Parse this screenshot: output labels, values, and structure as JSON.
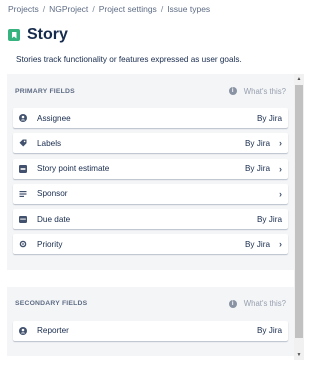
{
  "breadcrumb": {
    "items": [
      "Projects",
      "NGProject",
      "Project settings",
      "Issue types"
    ],
    "separator": "/"
  },
  "page": {
    "title": "Story",
    "icon": "story-icon",
    "description": "Stories track functionality or features expressed as user goals."
  },
  "primary_fields": {
    "title": "PRIMARY FIELDS",
    "whats_this": "What's this?",
    "fields": [
      {
        "label": "Assignee",
        "source": "By Jira",
        "has_chevron": false,
        "icon": "user-icon"
      },
      {
        "label": "Labels",
        "source": "By Jira",
        "has_chevron": true,
        "icon": "tag-icon"
      },
      {
        "label": "Story point estimate",
        "source": "By Jira",
        "has_chevron": true,
        "icon": "number-field-icon"
      },
      {
        "label": "Sponsor",
        "source": "",
        "has_chevron": true,
        "icon": "text-lines-icon"
      },
      {
        "label": "Due date",
        "source": "By Jira",
        "has_chevron": false,
        "icon": "calendar-icon"
      },
      {
        "label": "Priority",
        "source": "By Jira",
        "has_chevron": true,
        "icon": "priority-icon"
      }
    ]
  },
  "secondary_fields": {
    "title": "SECONDARY FIELDS",
    "whats_this": "What's this?",
    "fields": [
      {
        "label": "Reporter",
        "source": "By Jira",
        "has_chevron": false,
        "icon": "user-icon"
      }
    ]
  },
  "info_icon_glyph": "i",
  "chevron_glyph": "›",
  "colors": {
    "accent_story": "#36b37e",
    "panel_bg": "#f4f5f7",
    "text_primary": "#172b4d",
    "text_subtle": "#5e6c84"
  }
}
